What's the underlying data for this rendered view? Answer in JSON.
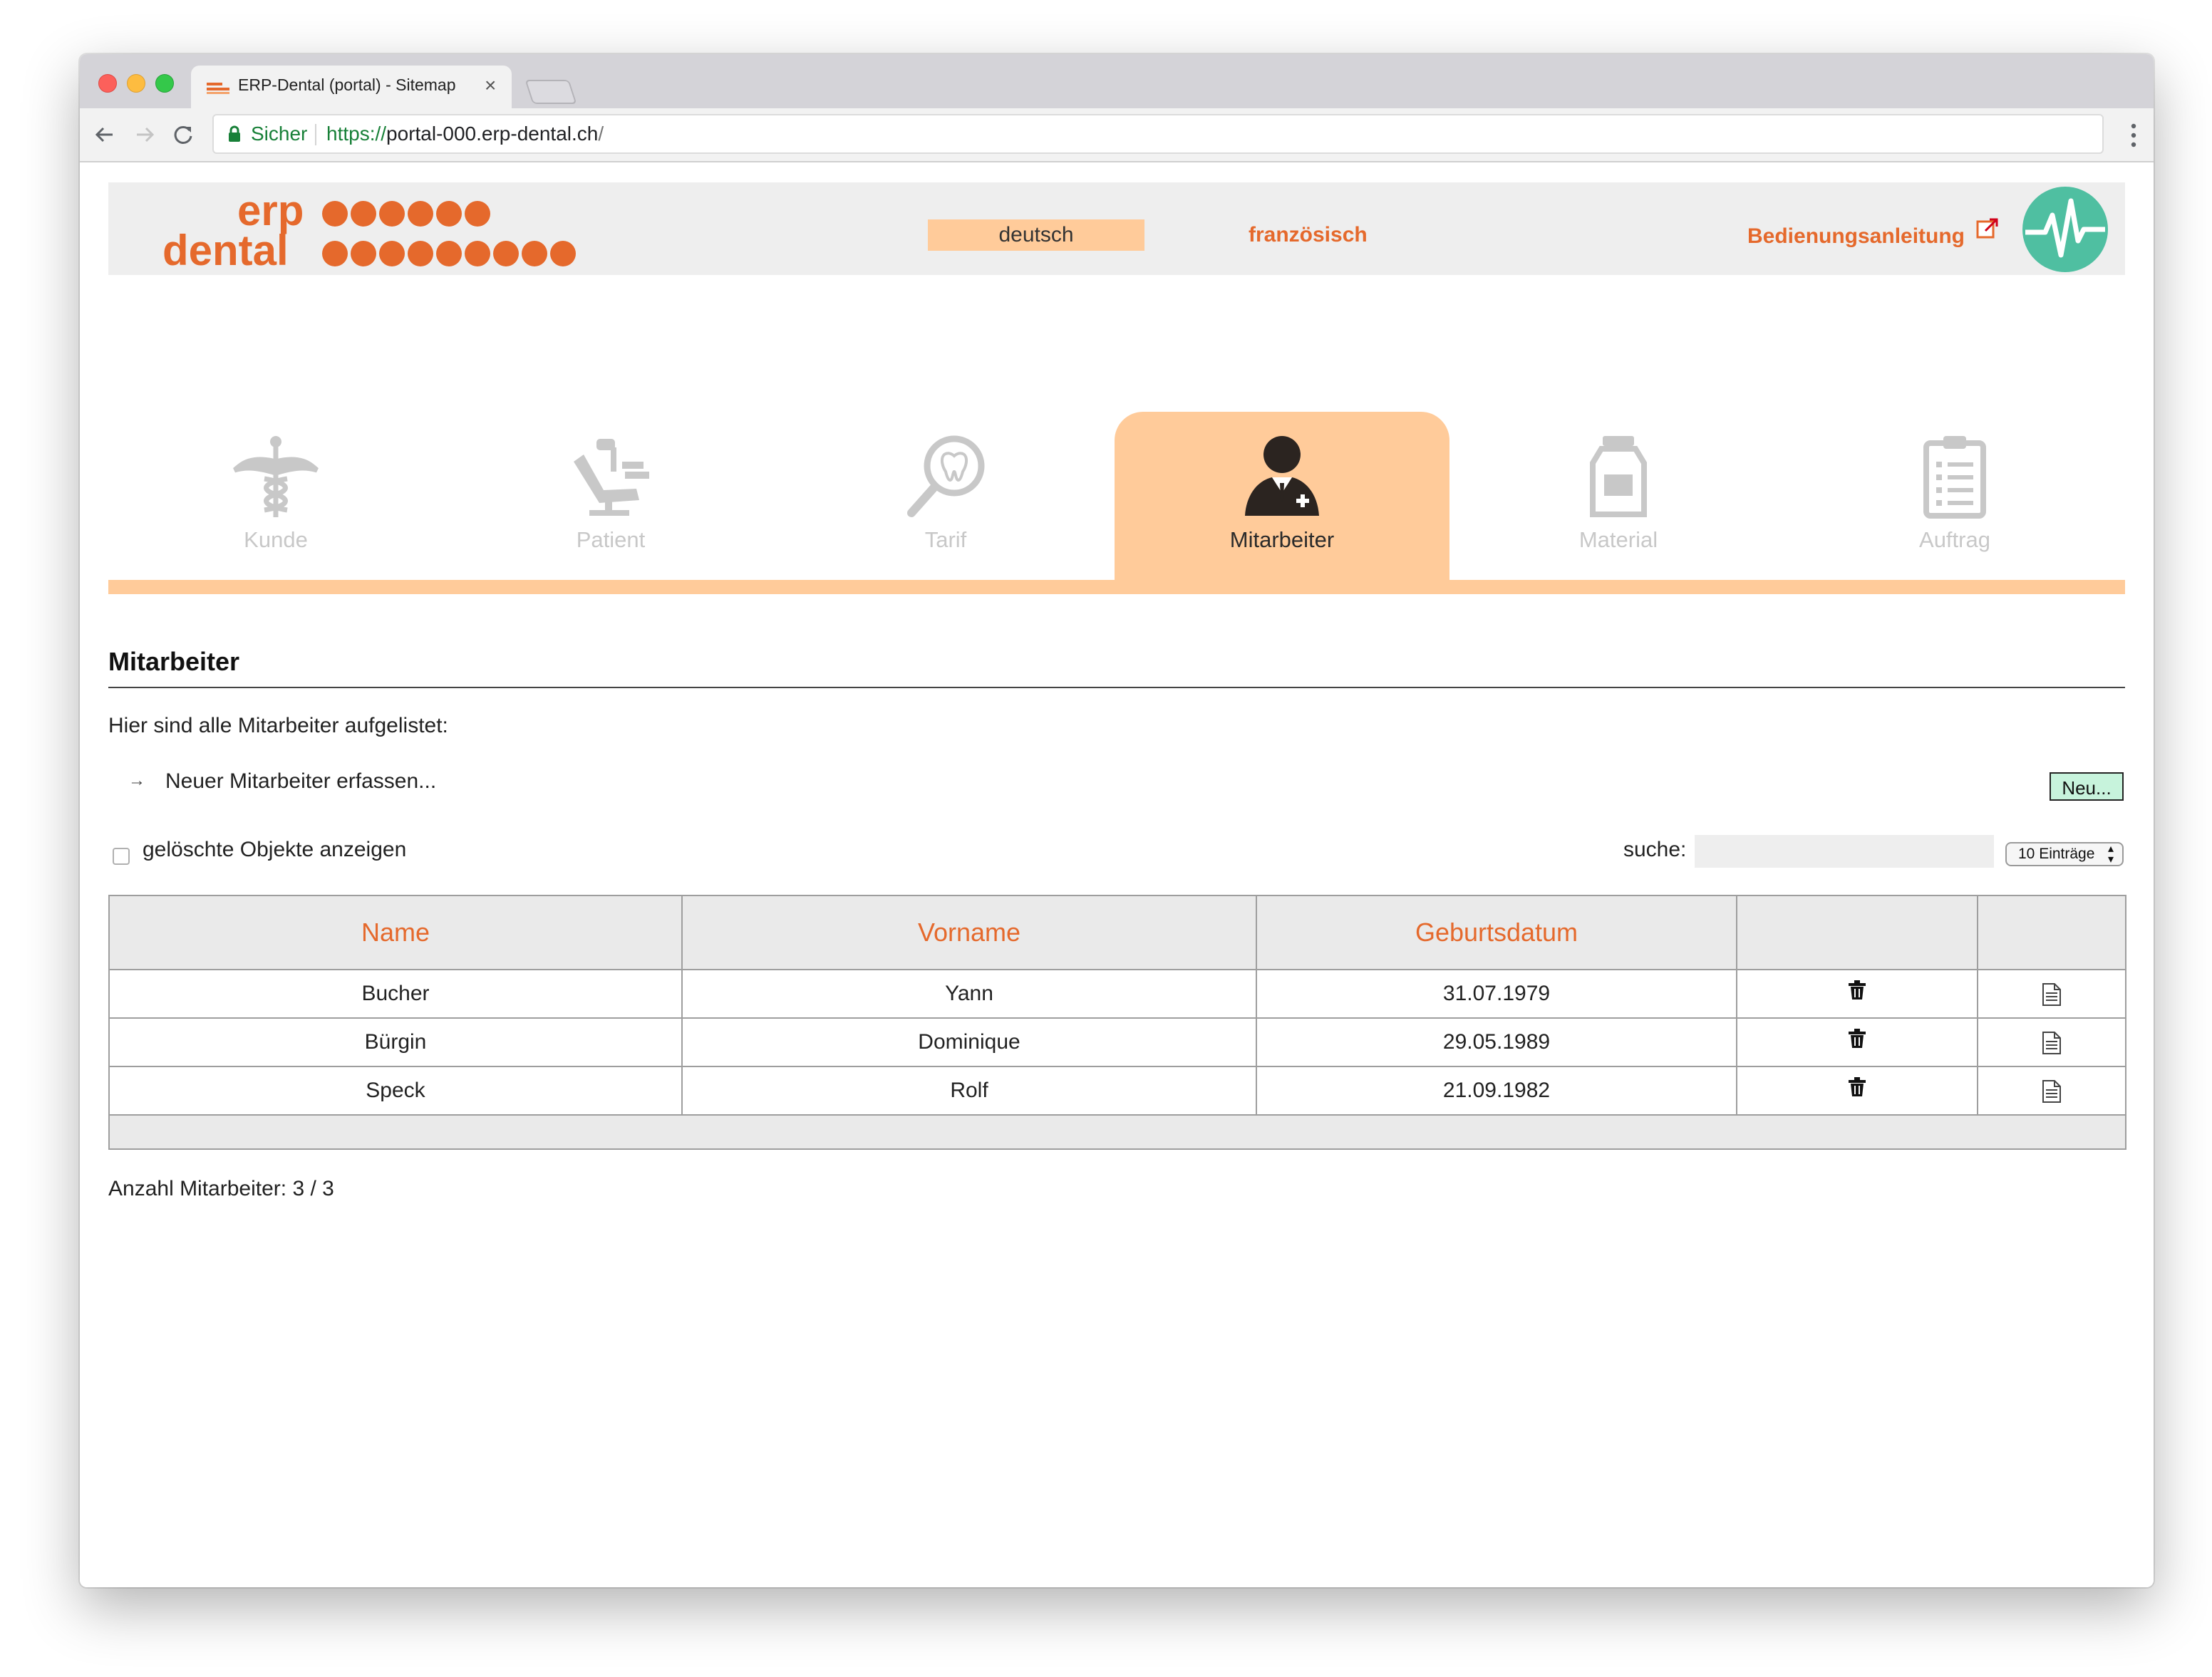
{
  "browser": {
    "tab_title": "ERP-Dental (portal) - Sitemap",
    "secure_label": "Sicher",
    "url_scheme": "https://",
    "url_host": "portal-000.erp-dental.ch",
    "url_path": "/"
  },
  "header": {
    "logo_line1": "erp",
    "logo_line2": "dental",
    "lang_active": "deutsch",
    "lang_other": "französisch",
    "manual_link": "Bedienungsanleitung"
  },
  "modules": [
    {
      "label": "Kunde",
      "icon": "caduceus-icon"
    },
    {
      "label": "Patient",
      "icon": "dental-chair-icon"
    },
    {
      "label": "Tarif",
      "icon": "tooth-magnifier-icon"
    },
    {
      "label": "Mitarbeiter",
      "icon": "doctor-icon",
      "active": true
    },
    {
      "label": "Material",
      "icon": "material-jar-icon"
    },
    {
      "label": "Auftrag",
      "icon": "clipboard-icon"
    }
  ],
  "content": {
    "title": "Mitarbeiter",
    "intro": "Hier sind alle Mitarbeiter aufgelistet:",
    "new_link": "Neuer Mitarbeiter erfassen...",
    "new_button": "Neu...",
    "show_deleted": "gelöschte Objekte anzeigen",
    "search_label": "suche:",
    "search_value": "",
    "entries_select": "10 Einträge",
    "count_text": "Anzahl Mitarbeiter: 3 / 3"
  },
  "table": {
    "headers": [
      "Name",
      "Vorname",
      "Geburtsdatum",
      "",
      ""
    ],
    "rows": [
      {
        "name": "Bucher",
        "vorname": "Yann",
        "geburtsdatum": "31.07.1979"
      },
      {
        "name": "Bürgin",
        "vorname": "Dominique",
        "geburtsdatum": "29.05.1989"
      },
      {
        "name": "Speck",
        "vorname": "Rolf",
        "geburtsdatum": "21.09.1982"
      }
    ]
  },
  "colors": {
    "accent": "#e5692c",
    "tab_highlight": "#ffcb9a",
    "new_button_bg": "#c7f3dc",
    "pulse_logo": "#4fbfa1"
  }
}
